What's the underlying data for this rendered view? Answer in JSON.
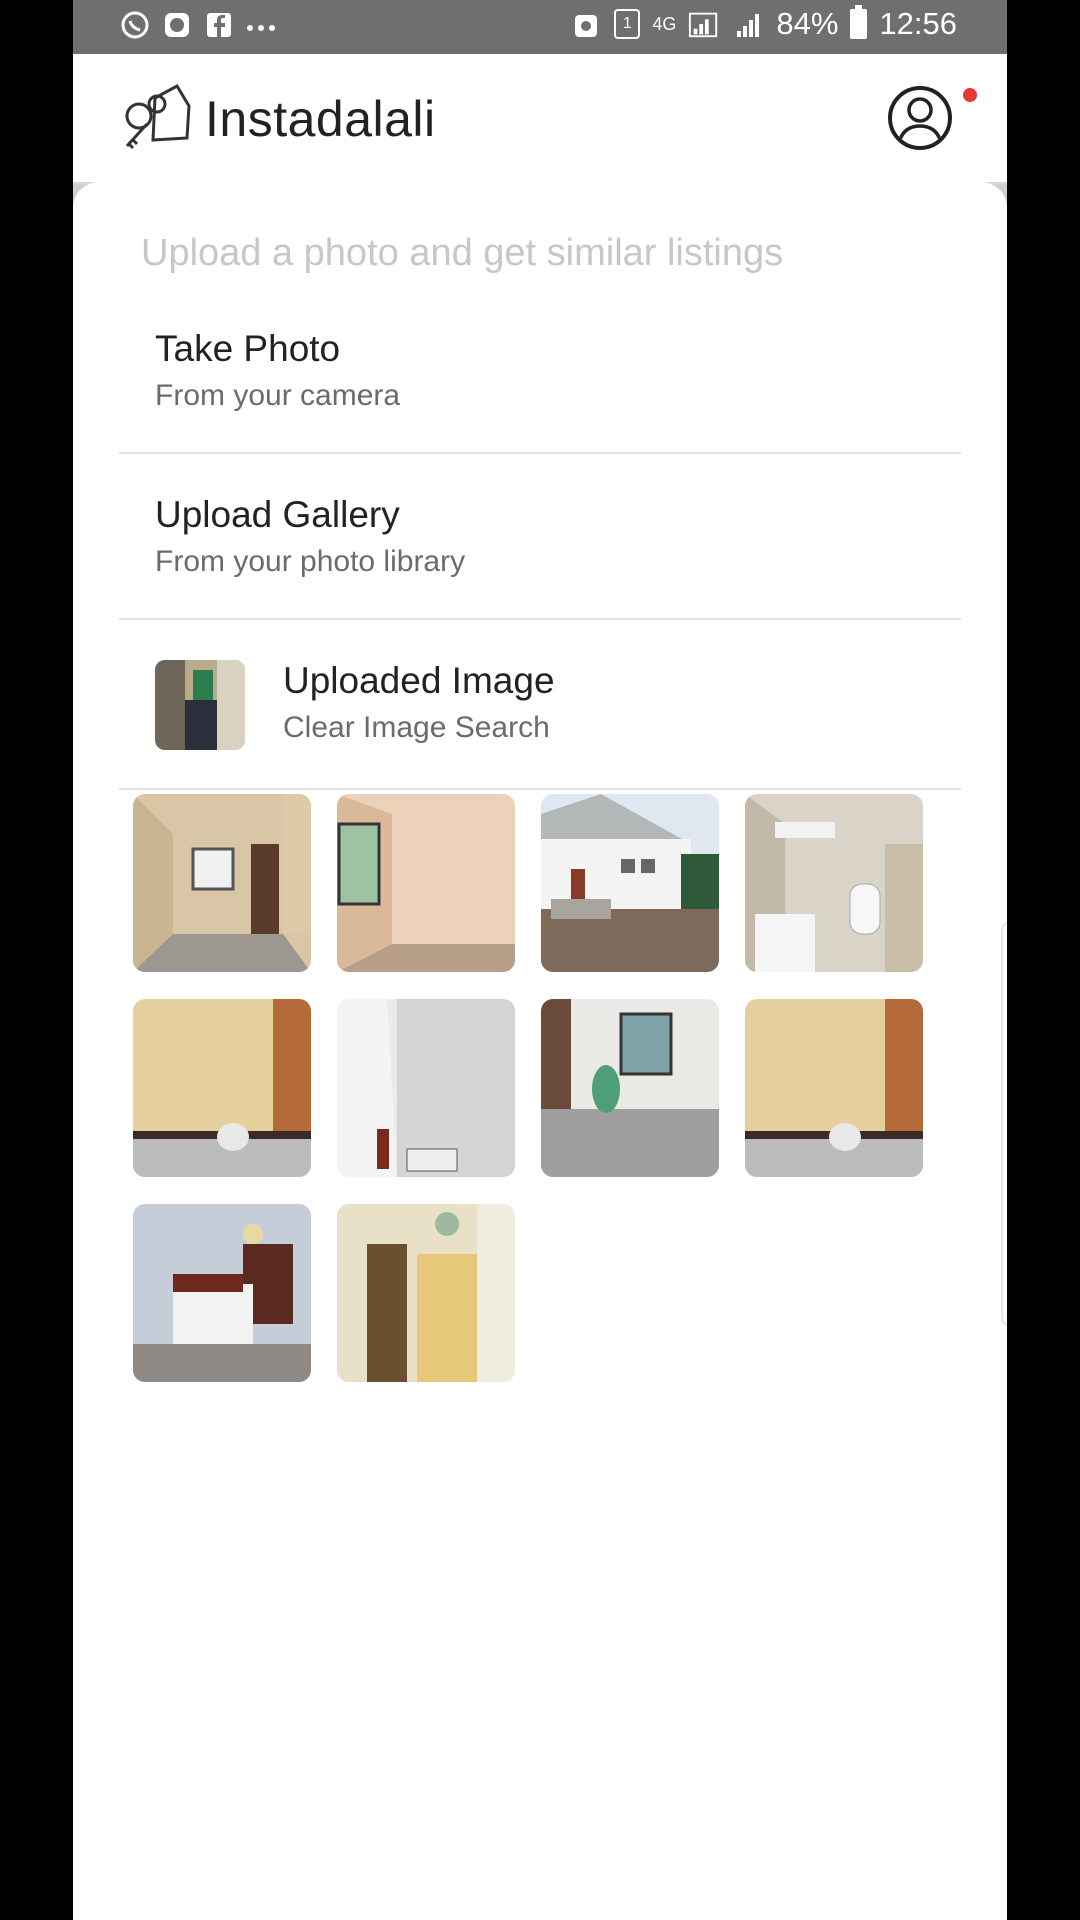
{
  "status_bar": {
    "left_icons": [
      "whatsapp-icon",
      "app-icon",
      "facebook-icon",
      "more-dots-icon"
    ],
    "network": "4G",
    "battery": "84%",
    "time": "12:56"
  },
  "app": {
    "title": "Instadalali"
  },
  "sheet": {
    "title": "Upload a photo and get similar listings",
    "options": [
      {
        "title": "Take Photo",
        "subtitle": "From your camera"
      },
      {
        "title": "Upload Gallery",
        "subtitle": "From your photo library"
      },
      {
        "title": "Uploaded Image",
        "subtitle": "Clear Image Search"
      }
    ]
  },
  "results": [
    {
      "name": "room-interior-1"
    },
    {
      "name": "room-interior-2"
    },
    {
      "name": "house-exterior"
    },
    {
      "name": "bathroom"
    },
    {
      "name": "room-door-1"
    },
    {
      "name": "room-corner"
    },
    {
      "name": "room-window"
    },
    {
      "name": "room-door-2"
    },
    {
      "name": "bedroom"
    },
    {
      "name": "hallway"
    }
  ],
  "colors": {
    "status_bar": "#6f6f6f",
    "accent_dot": "#e53935"
  }
}
